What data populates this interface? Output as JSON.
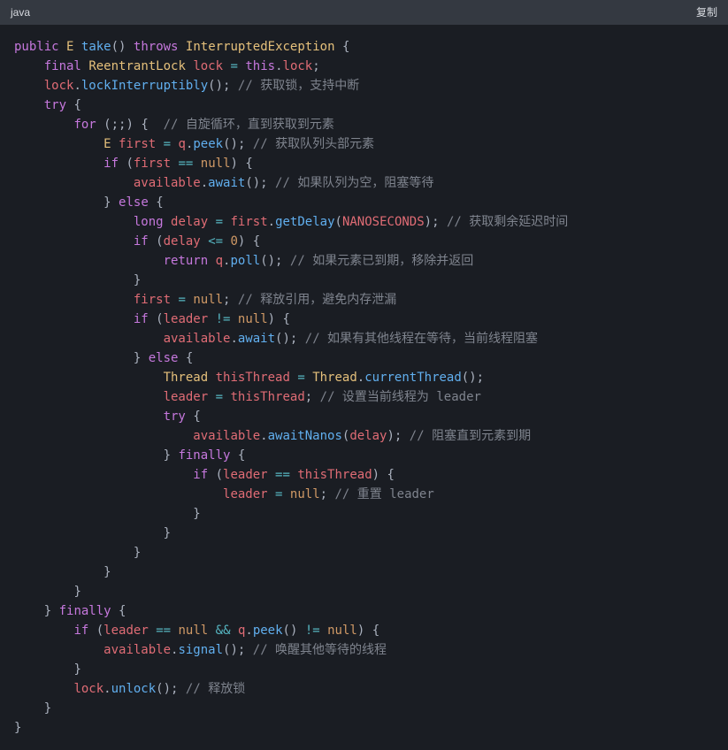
{
  "header": {
    "language": "java",
    "copy": "复制"
  },
  "code": {
    "c1": "// 获取锁，支持中断",
    "c2": "// 自旋循环，直到获取到元素",
    "c3": "// 获取队列头部元素",
    "c4": "// 如果队列为空，阻塞等待",
    "c5": "// 获取剩余延迟时间",
    "c6": "// 如果元素已到期，移除并返回",
    "c7": "// 释放引用，避免内存泄漏",
    "c8": "// 如果有其他线程在等待，当前线程阻塞",
    "c9": "// 设置当前线程为 leader",
    "c10": "// 阻塞直到元素到期",
    "c11": "// 重置 leader",
    "c12": "// 唤醒其他等待的线程",
    "c13": "// 释放锁",
    "kw_public": "public",
    "kw_throws": "throws",
    "kw_final": "final",
    "kw_try": "try",
    "kw_for": "for",
    "kw_if": "if",
    "kw_else": "else",
    "kw_return": "return",
    "kw_finally": "finally",
    "kw_long": "long",
    "kw_this": "this",
    "kw_null": "null",
    "ty_E": "E",
    "ty_InterruptedException": "InterruptedException",
    "ty_ReentrantLock": "ReentrantLock",
    "ty_Thread": "Thread",
    "id_lock": "lock",
    "id_first": "first",
    "id_q": "q",
    "id_delay": "delay",
    "id_leader": "leader",
    "id_available": "available",
    "id_thisThread": "thisThread",
    "id_NANOSECONDS": "NANOSECONDS",
    "fn_take": "take",
    "fn_lockInterruptibly": "lockInterruptibly",
    "fn_peek": "peek",
    "fn_await": "await",
    "fn_getDelay": "getDelay",
    "fn_poll": "poll",
    "fn_currentThread": "currentThread",
    "fn_awaitNanos": "awaitNanos",
    "fn_signal": "signal",
    "fn_unlock": "unlock",
    "num_0": "0"
  }
}
